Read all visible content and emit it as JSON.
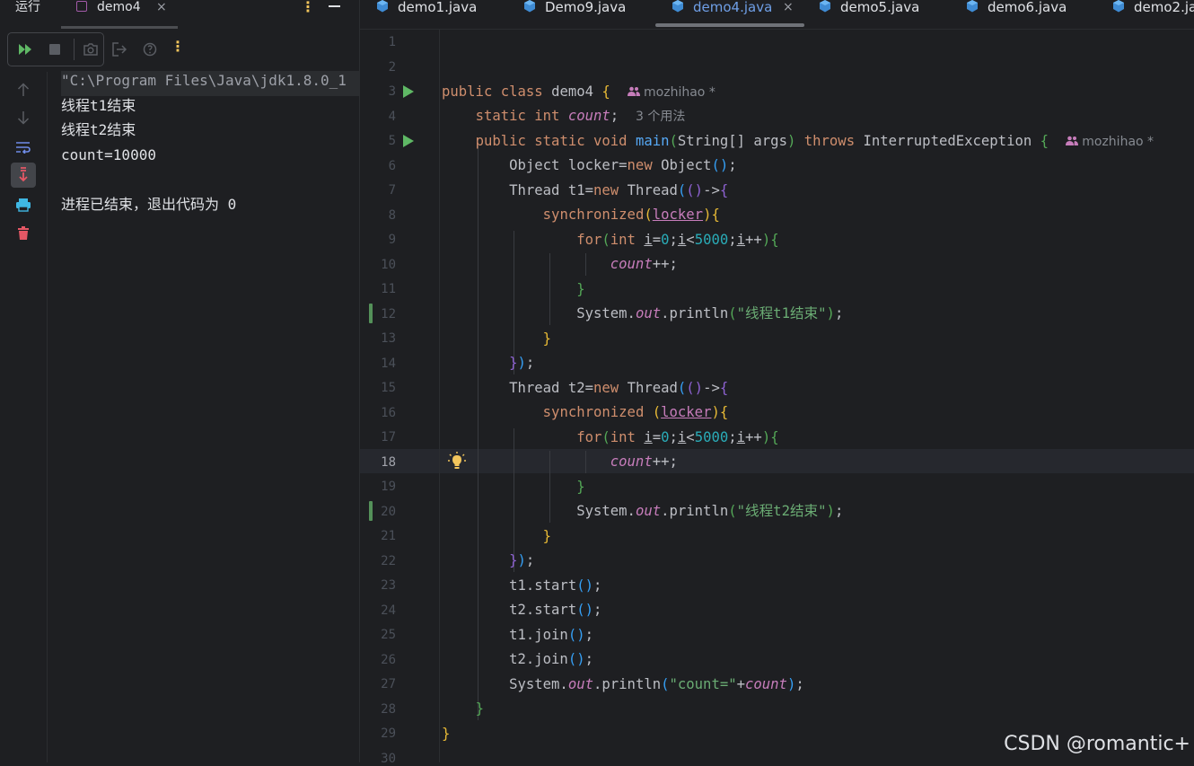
{
  "run_panel": {
    "title": "运行",
    "tab_label": "demo4",
    "tab_close": "×",
    "more": "⋮",
    "toolbar_more": "⋮",
    "console_lines": [
      "\"C:\\Program Files\\Java\\jdk1.8.0_1",
      "线程t1结束",
      "线程t2结束",
      "count=10000",
      "",
      "进程已结束，退出代码为 0"
    ]
  },
  "editor": {
    "tabs": [
      {
        "label": "demo1.java",
        "active": false
      },
      {
        "label": "Demo9.java",
        "active": false
      },
      {
        "label": "demo4.java",
        "active": true
      },
      {
        "label": "demo5.java",
        "active": false
      },
      {
        "label": "demo6.java",
        "active": false
      },
      {
        "label": "demo2.ja",
        "active": false
      }
    ],
    "tab_close": "×",
    "current_line": 18,
    "line_numbers": [
      "1",
      "2",
      "3",
      "4",
      "5",
      "6",
      "7",
      "8",
      "9",
      "10",
      "11",
      "12",
      "13",
      "14",
      "15",
      "16",
      "17",
      "18",
      "19",
      "20",
      "21",
      "22",
      "23",
      "24",
      "25",
      "26",
      "27",
      "28",
      "29",
      "30"
    ],
    "author": "mozhihao *",
    "usage_hint": "3 个用法",
    "strings": {
      "t1_done": "\"线程t1结束\"",
      "t2_done": "\"线程t2结束\"",
      "count_eq": "\"count=\""
    }
  },
  "colors": {
    "keyword": "#cf8e6d",
    "field": "#c77dbb",
    "method": "#56a8f5",
    "number": "#2aacb8",
    "string": "#6aab73",
    "run_icon": "#5fb865",
    "active_tab": "#6f9fe6"
  },
  "watermark": "CSDN @romantic+"
}
